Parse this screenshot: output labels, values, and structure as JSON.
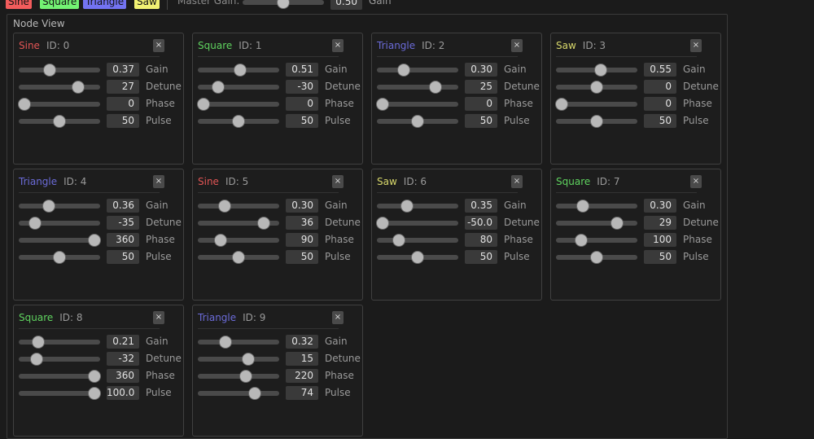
{
  "toolbar": {
    "tags": [
      {
        "label": "Sine",
        "color": "#f25c5c"
      },
      {
        "label": "Square",
        "color": "#73f273"
      },
      {
        "label": "Triangle",
        "color": "#7373f2"
      },
      {
        "label": "Saw",
        "color": "#f2f273"
      }
    ],
    "master_gain_label": "Master Gain:",
    "master_gain_value": "0.50",
    "master_gain_level": 0.5,
    "master_gain_unit": "Gain"
  },
  "node_view_title": "Node View",
  "close_glyph": "×",
  "type_colors": {
    "Sine": "#e25555",
    "Square": "#5fd35f",
    "Triangle": "#6b6bd8",
    "Saw": "#d8d86b"
  },
  "nodes": [
    {
      "type": "Sine",
      "id_text": "ID: 0",
      "params": [
        {
          "label": "Gain",
          "value": "0.37",
          "level": 0.38
        },
        {
          "label": "Detune",
          "value": "27",
          "level": 0.73
        },
        {
          "label": "Phase",
          "value": "0",
          "level": 0.07
        },
        {
          "label": "Pulse",
          "value": "50",
          "level": 0.5
        }
      ]
    },
    {
      "type": "Square",
      "id_text": "ID: 1",
      "params": [
        {
          "label": "Gain",
          "value": "0.51",
          "level": 0.52
        },
        {
          "label": "Detune",
          "value": "-30",
          "level": 0.25
        },
        {
          "label": "Phase",
          "value": "0",
          "level": 0.07
        },
        {
          "label": "Pulse",
          "value": "50",
          "level": 0.5
        }
      ]
    },
    {
      "type": "Triangle",
      "id_text": "ID: 2",
      "params": [
        {
          "label": "Gain",
          "value": "0.30",
          "level": 0.33
        },
        {
          "label": "Detune",
          "value": "25",
          "level": 0.72
        },
        {
          "label": "Phase",
          "value": "0",
          "level": 0.07
        },
        {
          "label": "Pulse",
          "value": "50",
          "level": 0.5
        }
      ]
    },
    {
      "type": "Saw",
      "id_text": "ID: 3",
      "params": [
        {
          "label": "Gain",
          "value": "0.55",
          "level": 0.55
        },
        {
          "label": "Detune",
          "value": "0",
          "level": 0.5
        },
        {
          "label": "Phase",
          "value": "0",
          "level": 0.07
        },
        {
          "label": "Pulse",
          "value": "50",
          "level": 0.5
        }
      ]
    },
    {
      "type": "Triangle",
      "id_text": "ID: 4",
      "params": [
        {
          "label": "Gain",
          "value": "0.36",
          "level": 0.37
        },
        {
          "label": "Detune",
          "value": "-35",
          "level": 0.2
        },
        {
          "label": "Phase",
          "value": "360",
          "level": 0.93
        },
        {
          "label": "Pulse",
          "value": "50",
          "level": 0.5
        }
      ]
    },
    {
      "type": "Sine",
      "id_text": "ID: 5",
      "params": [
        {
          "label": "Gain",
          "value": "0.30",
          "level": 0.33
        },
        {
          "label": "Detune",
          "value": "36",
          "level": 0.81
        },
        {
          "label": "Phase",
          "value": "90",
          "level": 0.28
        },
        {
          "label": "Pulse",
          "value": "50",
          "level": 0.5
        }
      ]
    },
    {
      "type": "Saw",
      "id_text": "ID: 6",
      "params": [
        {
          "label": "Gain",
          "value": "0.35",
          "level": 0.37
        },
        {
          "label": "Detune",
          "value": "-50.0",
          "level": 0.07
        },
        {
          "label": "Phase",
          "value": "80",
          "level": 0.27
        },
        {
          "label": "Pulse",
          "value": "50",
          "level": 0.5
        }
      ]
    },
    {
      "type": "Square",
      "id_text": "ID: 7",
      "params": [
        {
          "label": "Gain",
          "value": "0.30",
          "level": 0.33
        },
        {
          "label": "Detune",
          "value": "29",
          "level": 0.75
        },
        {
          "label": "Phase",
          "value": "100",
          "level": 0.31
        },
        {
          "label": "Pulse",
          "value": "50",
          "level": 0.5
        }
      ]
    },
    {
      "type": "Square",
      "id_text": "ID: 8",
      "params": [
        {
          "label": "Gain",
          "value": "0.21",
          "level": 0.24
        },
        {
          "label": "Detune",
          "value": "-32",
          "level": 0.22
        },
        {
          "label": "Phase",
          "value": "360",
          "level": 0.93
        },
        {
          "label": "Pulse",
          "value": "100.0",
          "level": 0.93
        }
      ]
    },
    {
      "type": "Triangle",
      "id_text": "ID: 9",
      "params": [
        {
          "label": "Gain",
          "value": "0.32",
          "level": 0.34
        },
        {
          "label": "Detune",
          "value": "15",
          "level": 0.62
        },
        {
          "label": "Phase",
          "value": "220",
          "level": 0.59
        },
        {
          "label": "Pulse",
          "value": "74",
          "level": 0.7
        }
      ]
    }
  ]
}
